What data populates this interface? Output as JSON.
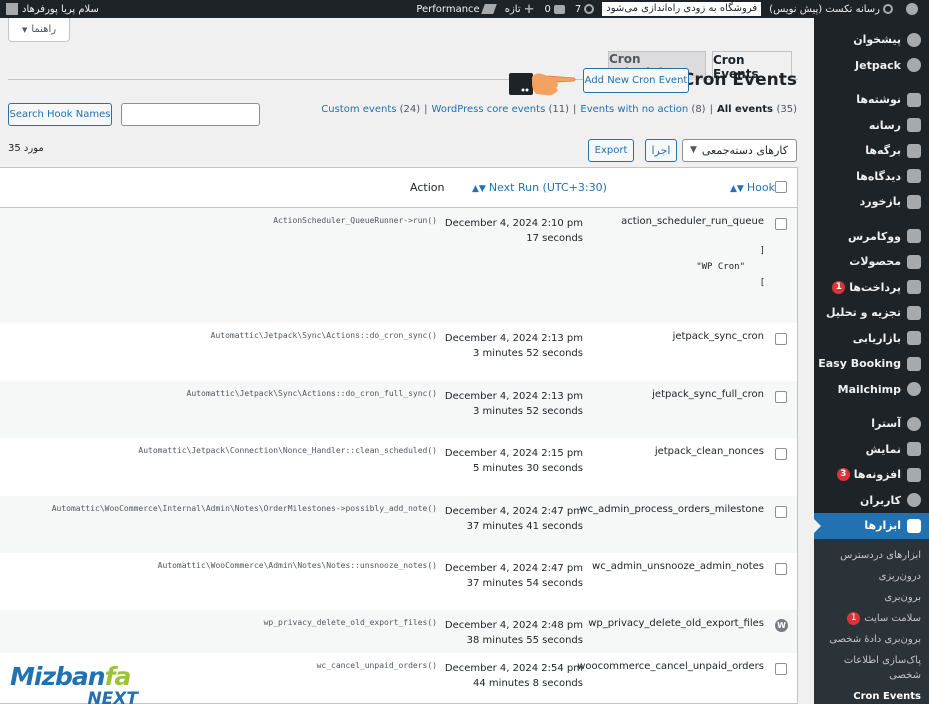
{
  "adminbar": {
    "site_name": "رسانه نکست (پیش نویس)",
    "updates_count": "7",
    "comments_count": "0",
    "new_label": "تازه",
    "performance_label": "Performance",
    "coming_soon": "فروشگاه به زودی راه‌اندازی می‌شود",
    "howdy": "سلام پریا پورفرهاد"
  },
  "help_tab": {
    "label": "راهنما"
  },
  "tabs": [
    {
      "label": "Cron Events"
    },
    {
      "label": "Cron Schedules"
    }
  ],
  "page": {
    "title": "Cron Events",
    "add_new_label": "Add New Cron Event"
  },
  "views": [
    {
      "label": "All events",
      "count": "(35)"
    },
    {
      "label": "Events with no action",
      "count": "(8)"
    },
    {
      "label": "WordPress core events",
      "count": "(11)"
    },
    {
      "label": "Custom events",
      "count": "(24)"
    }
  ],
  "search": {
    "button_label": "Search Hook Names",
    "value": ""
  },
  "bulk": {
    "select_value": "کارهای دسته‌جمعی",
    "apply_label": "اجرا",
    "export_label": "Export"
  },
  "items_count": "35 مورد",
  "table": {
    "columns": {
      "hook": "Hook",
      "next_run": "Next Run (UTC+3:30)",
      "action": "Action"
    },
    "rows": [
      {
        "hook": "action_scheduler_run_queue",
        "date": "December 4, 2024 2:10 pm",
        "relative": "17 seconds",
        "action": "ActionScheduler_QueueRunner->run()",
        "args": [
          "]",
          "\"WP Cron\"",
          "["
        ]
      },
      {
        "hook": "jetpack_sync_cron",
        "date": "December 4, 2024 2:13 pm",
        "relative": "3 minutes 52 seconds",
        "action": "Automattic\\Jetpack\\Sync\\Actions::do_cron_sync()"
      },
      {
        "hook": "jetpack_sync_full_cron",
        "date": "December 4, 2024 2:13 pm",
        "relative": "3 minutes 52 seconds",
        "action": "Automattic\\Jetpack\\Sync\\Actions::do_cron_full_sync()"
      },
      {
        "hook": "jetpack_clean_nonces",
        "date": "December 4, 2024 2:15 pm",
        "relative": "5 minutes 30 seconds",
        "action": "Automattic\\Jetpack\\Connection\\Nonce_Handler::clean_scheduled()"
      },
      {
        "hook": "wc_admin_process_orders_milestone",
        "date": "December 4, 2024 2:47 pm",
        "relative": "37 minutes 41 seconds",
        "action": "Automattic\\WooCommerce\\Internal\\Admin\\Notes\\OrderMilestones->possibly_add_note()"
      },
      {
        "hook": "wc_admin_unsnooze_admin_notes",
        "date": "December 4, 2024 2:47 pm",
        "relative": "37 minutes 54 seconds",
        "action": "Automattic\\WooCommerce\\Admin\\Notes\\Notes::unsnooze_notes()"
      },
      {
        "hook": "wp_privacy_delete_old_export_files",
        "date": "December 4, 2024 2:48 pm",
        "relative": "38 minutes 55 seconds",
        "action": "wp_privacy_delete_old_export_files()"
      },
      {
        "hook": "woocommerce_cancel_unpaid_orders",
        "date": "December 4, 2024 2:54 pm",
        "relative": "44 minutes 8 seconds",
        "action": "wc_cancel_unpaid_orders()"
      }
    ]
  },
  "sidebar": {
    "items": [
      {
        "label": "پیشخوان",
        "icon": "dashboard-icon"
      },
      {
        "label": "Jetpack",
        "icon": "jetpack-icon"
      },
      {
        "label": "نوشته‌ها",
        "icon": "pin-icon"
      },
      {
        "label": "رسانه",
        "icon": "media-icon"
      },
      {
        "label": "برگه‌ها",
        "icon": "pages-icon"
      },
      {
        "label": "دیدگاه‌ها",
        "icon": "comments-icon"
      },
      {
        "label": "بازخورد",
        "icon": "feedback-icon"
      },
      {
        "label": "ووکامرس",
        "icon": "woocommerce-icon"
      },
      {
        "label": "محصولات",
        "icon": "products-icon"
      },
      {
        "label": "پرداخت‌ها",
        "icon": "payments-icon",
        "badge": "1"
      },
      {
        "label": "تجزیه و تحلیل",
        "icon": "analytics-icon"
      },
      {
        "label": "بازاریابی",
        "icon": "marketing-icon"
      },
      {
        "label": "Easy Booking",
        "icon": "calendar-icon"
      },
      {
        "label": "Mailchimp",
        "icon": "mailchimp-icon"
      },
      {
        "label": "آسترا",
        "icon": "astra-icon"
      },
      {
        "label": "نمایش",
        "icon": "appearance-icon"
      },
      {
        "label": "افزونه‌ها",
        "icon": "plugins-icon",
        "badge": "3"
      },
      {
        "label": "کاربران",
        "icon": "users-icon"
      },
      {
        "label": "ابزارها",
        "icon": "tools-icon"
      }
    ],
    "submenu": [
      {
        "label": "ابزارهای دردسترس"
      },
      {
        "label": "درون‌ریزی"
      },
      {
        "label": "برون‌بری"
      },
      {
        "label": "سلامت سایت",
        "badge": "1"
      },
      {
        "label": "برون‌بری دادهٔ شخصی"
      },
      {
        "label": "پاک‌سازی اطلاعات شخصی"
      },
      {
        "label": "Cron Events"
      }
    ]
  },
  "logo": {
    "line1a": "Mizban",
    "line1b": "fa",
    "line2": "NEXT"
  }
}
